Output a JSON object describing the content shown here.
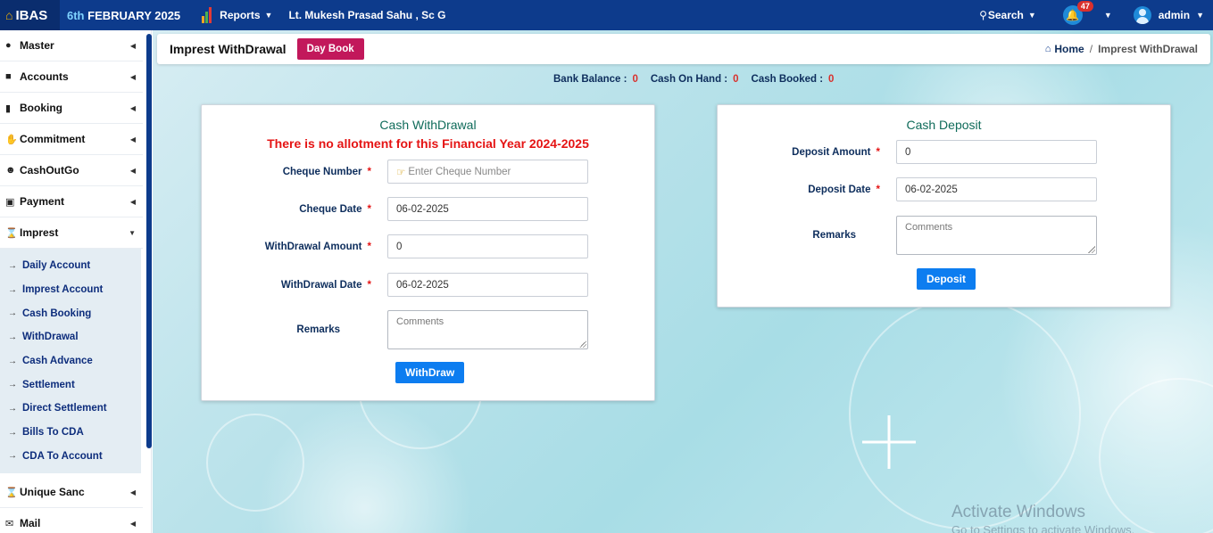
{
  "topbar": {
    "brand": "IBAS",
    "date_day": "6th",
    "date_rest": "FEBRUARY 2025",
    "reports_label": "Reports",
    "officer": "Lt. Mukesh Prasad Sahu , Sc G",
    "search_label": "Search",
    "notification_count": "47",
    "user": "admin"
  },
  "sidebar": {
    "items": [
      {
        "label": "Master",
        "icon": "user-icon"
      },
      {
        "label": "Accounts",
        "icon": "briefcase-icon"
      },
      {
        "label": "Booking",
        "icon": "book-icon"
      },
      {
        "label": "Commitment",
        "icon": "handshake-icon"
      },
      {
        "label": "CashOutGo",
        "icon": "user-secret-icon"
      },
      {
        "label": "Payment",
        "icon": "money-icon"
      },
      {
        "label": "Imprest",
        "icon": "hourglass-icon"
      }
    ],
    "imprest_sub": [
      "Daily Account",
      "Imprest Account",
      "Cash Booking",
      "WithDrawal",
      "Cash Advance",
      "Settlement",
      "Direct Settlement",
      "Bills To CDA",
      "CDA To Account"
    ],
    "items_after": [
      {
        "label": "Unique Sanc",
        "icon": "hourglass-icon"
      },
      {
        "label": "Mail",
        "icon": "envelope-icon"
      }
    ]
  },
  "header": {
    "title": "Imprest WithDrawal",
    "daybook_label": "Day Book",
    "breadcrumb_home": "Home",
    "breadcrumb_sep": "/",
    "breadcrumb_current": "Imprest WithDrawal"
  },
  "balances": {
    "bank_label": "Bank Balance :",
    "bank_value": "0",
    "cash_label": "Cash On Hand :",
    "cash_value": "0",
    "booked_label": "Cash Booked :",
    "booked_value": "0"
  },
  "withdrawal": {
    "title": "Cash WithDrawal",
    "alert": "There is no allotment for this Financial Year  2024-2025",
    "cheque_number_label": "Cheque Number",
    "cheque_number_placeholder": "Enter Cheque Number",
    "cheque_date_label": "Cheque Date",
    "cheque_date_value": "06-02-2025",
    "amount_label": "WithDrawal Amount",
    "amount_value": "0",
    "date_label": "WithDrawal Date",
    "date_value": "06-02-2025",
    "remarks_label": "Remarks",
    "remarks_placeholder": "Comments",
    "button_label": "WithDraw"
  },
  "deposit": {
    "title": "Cash Deposit",
    "amount_label": "Deposit Amount",
    "amount_value": "0",
    "date_label": "Deposit Date",
    "date_value": "06-02-2025",
    "remarks_label": "Remarks",
    "remarks_placeholder": "Comments",
    "button_label": "Deposit"
  },
  "required_mark": "*",
  "watermark": {
    "line1": "Activate Windows",
    "line2": "Go to Settings to activate Windows."
  },
  "colors": {
    "topbar": "#0d3b8c",
    "daybook": "#c2185b",
    "primary_button": "#0d7df0",
    "alert": "#e51414",
    "card_title": "#0f6b5a"
  }
}
